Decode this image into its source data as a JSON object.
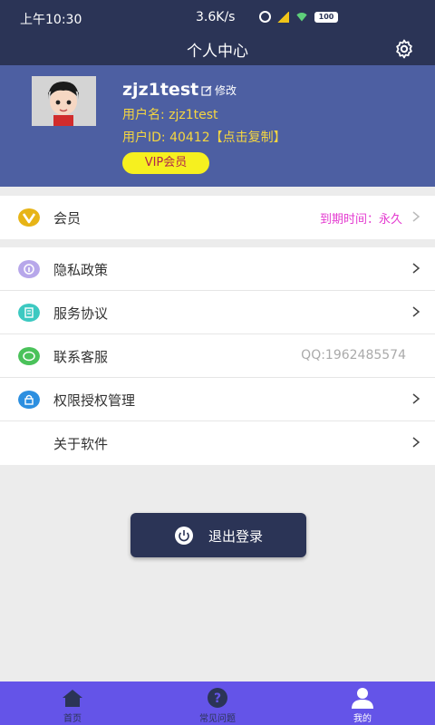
{
  "status_bar": {
    "time": "上午10:30",
    "network_speed": "3.6K/s",
    "battery": "100"
  },
  "header": {
    "title": "个人中心",
    "settings_icon": "gear-icon"
  },
  "profile": {
    "username": "zjz1test",
    "edit_label": "修改",
    "account_line": "用户名: zjz1test",
    "user_id_line": "用户ID: 40412【点击复制】",
    "vip_badge": "VIP会员"
  },
  "membership": {
    "label": "会员",
    "expiry_text": "到期时间：永久"
  },
  "menu": {
    "items": [
      {
        "label": "隐私政策",
        "icon": "info-icon"
      },
      {
        "label": "服务协议",
        "icon": "document-icon"
      },
      {
        "label": "联系客服",
        "icon": "chat-icon",
        "value": "QQ:1962485574"
      },
      {
        "label": "权限授权管理",
        "icon": "lock-icon"
      },
      {
        "label": "关于软件"
      }
    ]
  },
  "logout": {
    "label": "退出登录"
  },
  "bottom_nav": {
    "tabs": [
      {
        "label": "首页",
        "icon": "home-icon"
      },
      {
        "label": "常见问题",
        "icon": "question-icon"
      },
      {
        "label": "我的",
        "icon": "user-icon"
      }
    ]
  },
  "colors": {
    "header_bg": "#2b3456",
    "profile_bg": "#4d5fa2",
    "accent_yellow": "#f5d640",
    "vip_badge_bg": "#f6f01f",
    "expiry_text": "#e43bd0",
    "bottom_nav_bg": "#6454e8"
  }
}
